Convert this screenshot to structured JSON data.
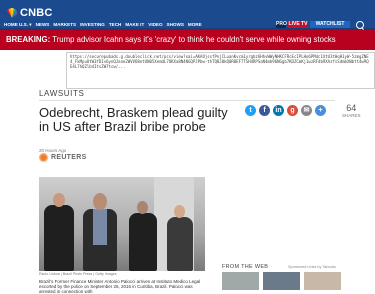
{
  "header": {
    "logo_text": "CNBC",
    "edition": "HOME U.S. ▾",
    "nav": [
      "NEWS",
      "MARKETS",
      "INVESTING",
      "TECH",
      "MAKE IT",
      "VIDEO",
      "SHOWS",
      "MORE"
    ],
    "pro_label": "PRO",
    "live_label": "LIVE TV",
    "watchlist_label": "WATCHLIST"
  },
  "breaking": {
    "prefix": "BREAKING:",
    "text": " Trump advisor Icahn says it's 'crazy' to think he couldn't serve while owning stocks"
  },
  "url_overlay": "https://securepubads.g.doubleclick.net/pcs/view?xai=AKAOjssfPnjCLuanKvcm1yrgbz6HhvWWyNHKCFRcEcIPLHo6PMdc1XtU3tHqH1yW-5zmgZNE4_FkMpuOtW3fDIv6ynQJane2WVVO8etUN05XemdL7OKXa8N4NGQPJPbw-thTQ8J0kQ0R8EF7TSH4RPSaN4mb96NGgb7KDZCmKj1wzRFdb9XAzfsSdmbXWbtt4w9QE4L7hQZlb4ItsZW7tcw/...",
  "article": {
    "section": "LAWSUITS",
    "headline": "Odebrecht, Braskem plead guilty in US after Brazil bribe probe",
    "timestamp": "20 Hours Ago",
    "source": "REUTERS",
    "shares_count": "64",
    "shares_label": "SHARES",
    "caption": "Paulo Lisboa | Brazil Photo Press | Getty Images",
    "body": "Brazil's Former Finance Minister Antonio Palocci arrives at Instituto Medico Legal escorted by the police on September 26, 2016 in Curitiba, Brazil. Palocci was arrested in connection with"
  },
  "sidebar": {
    "from_web_label": "FROM THE WEB",
    "sponsored_label": "Sponsored Links by Taboola"
  },
  "social_icons": [
    "twitter-icon",
    "facebook-icon",
    "linkedin-icon",
    "google-plus-icon",
    "email-icon",
    "more-share-icon"
  ],
  "colors": {
    "nav_bg": "#1c4a8e",
    "breaking_bg": "#b8001f",
    "live_red": "#c8102e",
    "watchlist_blue": "#1f66c2"
  }
}
